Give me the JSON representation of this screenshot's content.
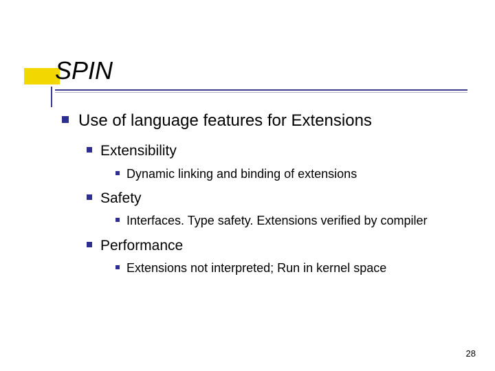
{
  "slide": {
    "title": "SPIN",
    "page_number": "28",
    "bullets": {
      "l1": "Use of language features for Extensions",
      "items": [
        {
          "heading": "Extensibility",
          "detail": "Dynamic linking and binding of extensions"
        },
        {
          "heading": "Safety",
          "detail": "Interfaces. Type safety. Extensions verified by compiler"
        },
        {
          "heading": "Performance",
          "detail": "Extensions not interpreted; Run in kernel space"
        }
      ]
    }
  }
}
